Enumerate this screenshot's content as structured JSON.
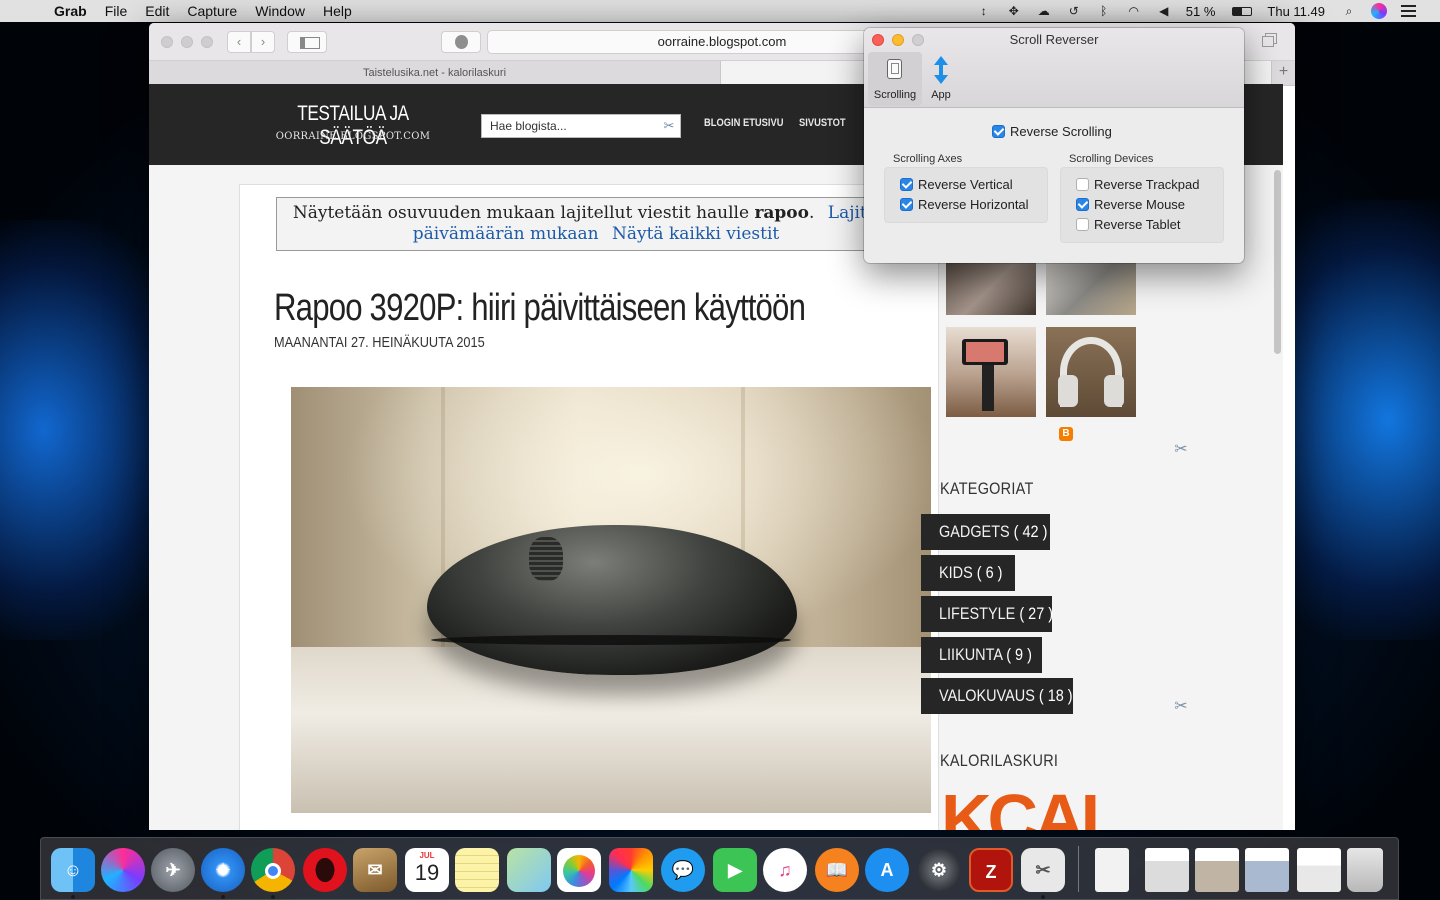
{
  "menubar": {
    "app_name": "Grab",
    "menus": [
      "File",
      "Edit",
      "Capture",
      "Window",
      "Help"
    ],
    "battery": "51 %",
    "clock": "Thu 11.49"
  },
  "browser": {
    "url": "oorraine.blogspot.com",
    "tab_title": "Taistelusika.net - kalorilaskuri"
  },
  "blog": {
    "title": "TESTAILUA JA SÄÄTÖÄ",
    "subtitle": "OORRAINE.BLOGSPOT.COM",
    "search_placeholder": "Hae blogista...",
    "nav": [
      "BLOGIN ETUSIVU",
      "SIVUSTOT"
    ],
    "notice": {
      "prefix": "Näytetään osuvuuden mukaan lajitellut viestit haulle ",
      "query": "rapoo",
      "suffix": ".",
      "link_sort": "Lajittele päivämäärän mukaan",
      "link_sort_line1": "Lajittele",
      "link_sort_line2": "päivämäärän mukaan",
      "link_all": "Näytä kaikki viestit"
    },
    "post": {
      "title": "Rapoo 3920P: hiiri päivittäiseen käyttöön",
      "date": "MAANANTAI 27. HEINÄKUUTA 2015"
    },
    "sidebar": {
      "categories_heading": "KATEGORIAT",
      "categories": [
        {
          "name": "GADGETS",
          "count": "( 42 )"
        },
        {
          "name": "KIDS",
          "count": "( 6 )"
        },
        {
          "name": "LIFESTYLE",
          "count": "( 27 )"
        },
        {
          "name": "LIIKUNTA",
          "count": "( 9 )"
        },
        {
          "name": "VALOKUVAUS",
          "count": "( 18 )"
        }
      ],
      "calorie_heading": "KALORILASKURI",
      "calorie_logo": "KCAL"
    }
  },
  "scroll_reverser": {
    "window_title": "Scroll Reverser",
    "tabs": [
      {
        "label": "Scrolling",
        "active": true
      },
      {
        "label": "App",
        "active": false
      }
    ],
    "reverse_scrolling": {
      "label": "Reverse Scrolling",
      "checked": true
    },
    "axes_label": "Scrolling Axes",
    "axes": [
      {
        "label": "Reverse Vertical",
        "checked": true
      },
      {
        "label": "Reverse Horizontal",
        "checked": true
      }
    ],
    "devices_label": "Scrolling Devices",
    "devices": [
      {
        "label": "Reverse Trackpad",
        "checked": false
      },
      {
        "label": "Reverse Mouse",
        "checked": true
      },
      {
        "label": "Reverse Tablet",
        "checked": false
      }
    ]
  },
  "dock": {
    "apps": [
      "Finder",
      "Siri",
      "Launchpad",
      "Safari",
      "Chrome",
      "Opera",
      "Mail",
      "Calendar",
      "Notes",
      "Maps",
      "Photos",
      "Pinwheel",
      "Messages",
      "FaceTime",
      "iTunes",
      "iBooks",
      "App Store",
      "System Preferences",
      "FileZilla",
      "Grab",
      "Document",
      "Screenshot 1",
      "Screenshot 2",
      "Screenshot 3",
      "Screenshot 4",
      "Trash"
    ],
    "calendar_month": "JUL",
    "calendar_day": "19",
    "filezilla_letter": "Z"
  }
}
